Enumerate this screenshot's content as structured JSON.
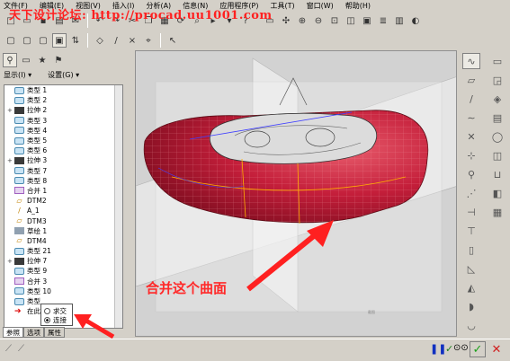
{
  "menu": [
    "文件(F)",
    "编辑(E)",
    "视图(V)",
    "插入(I)",
    "分析(A)",
    "信息(N)",
    "应用程序(P)",
    "工具(T)",
    "窗口(W)",
    "帮助(H)"
  ],
  "watermark": "天下设计论坛: http://procad.uu1001.com",
  "panel_header": {
    "show": "显示(I) ▾",
    "settings": "设置(G) ▾"
  },
  "tree": [
    {
      "label": "类型 1",
      "icon": "feature-icon",
      "expand": ""
    },
    {
      "label": "类型 2",
      "icon": "feature-icon",
      "expand": ""
    },
    {
      "label": "拉伸 2",
      "icon": "extrude-icon",
      "expand": "+"
    },
    {
      "label": "类型 3",
      "icon": "feature-icon",
      "expand": ""
    },
    {
      "label": "类型 4",
      "icon": "feature-icon",
      "expand": ""
    },
    {
      "label": "类型 5",
      "icon": "feature-icon",
      "expand": ""
    },
    {
      "label": "类型 6",
      "icon": "feature-icon",
      "expand": ""
    },
    {
      "label": "拉伸 3",
      "icon": "extrude-icon",
      "expand": "+"
    },
    {
      "label": "类型 7",
      "icon": "feature-icon",
      "expand": ""
    },
    {
      "label": "类型 8",
      "icon": "feature-icon",
      "expand": ""
    },
    {
      "label": "合并 1",
      "icon": "merge-icon",
      "expand": ""
    },
    {
      "label": "DTM2",
      "icon": "datum-plane-icon",
      "expand": ""
    },
    {
      "label": "A_1",
      "icon": "axis-icon",
      "expand": ""
    },
    {
      "label": "DTM3",
      "icon": "datum-plane-icon",
      "expand": ""
    },
    {
      "label": "草绘 1",
      "icon": "sketch-icon",
      "expand": ""
    },
    {
      "label": "DTM4",
      "icon": "datum-plane-icon",
      "expand": ""
    },
    {
      "label": "类型 21",
      "icon": "feature-icon",
      "expand": ""
    },
    {
      "label": "拉伸 7",
      "icon": "extrude-icon",
      "expand": "+"
    },
    {
      "label": "类型 9",
      "icon": "feature-icon",
      "expand": ""
    },
    {
      "label": "合并 3",
      "icon": "merge-icon",
      "expand": ""
    },
    {
      "label": "类型 10",
      "icon": "feature-icon",
      "expand": ""
    },
    {
      "label": "类型",
      "icon": "feature-icon",
      "expand": ""
    },
    {
      "label": "在此",
      "icon": "insert-here-icon",
      "expand": ""
    }
  ],
  "popup": {
    "opt1": "求交",
    "opt2": "连接",
    "selected": "连接"
  },
  "tabs": [
    "参照",
    "选项",
    "属性"
  ],
  "annotation": "合并这个曲面",
  "colors": {
    "surface": "#c41e3a",
    "annotation": "#ff2a2a",
    "watermark": "#ff2020",
    "ok_button": "#1aa01a",
    "cancel_button": "#d02020",
    "pause_button": "#1030c0"
  }
}
